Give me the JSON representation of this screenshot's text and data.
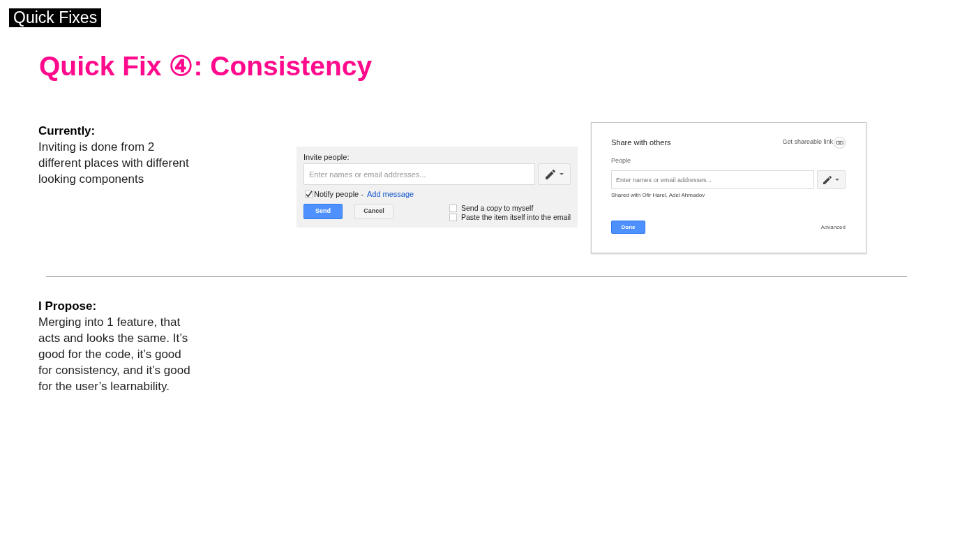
{
  "section_label": "Quick Fixes",
  "title": "Quick Fix ④: Consistency",
  "current": {
    "heading": "Currently:",
    "lines": [
      "Inviting is done from 2",
      "different places with different",
      "looking components"
    ]
  },
  "screenshots": [
    {
      "kind": "invite_panel",
      "label": "Invite people:",
      "input": {
        "placeholder": "Enter names or email addresses..."
      },
      "notify": {
        "label": "Notify people -",
        "checked": true,
        "link": "Add message"
      },
      "buttons": [
        {
          "label": "Send",
          "primary": true
        },
        {
          "label": "Cancel",
          "primary": false
        }
      ],
      "options": [
        {
          "label": "Send a copy to myself",
          "checked": false
        },
        {
          "label": "Paste the item itself into the email",
          "checked": false
        }
      ]
    },
    {
      "kind": "share_dialog",
      "title": "Share with others",
      "link_label": "Get shareable link",
      "field_label": "People",
      "input": {
        "placeholder": "Enter names or email addresses..."
      },
      "shared_with": "Shared with Ofir Harel, Adel Ahmadov",
      "buttons": [
        {
          "label": "Done",
          "primary": true
        }
      ],
      "advanced": "Advanced"
    }
  ],
  "proposal": {
    "heading": "I Propose:",
    "lines": [
      "Merging into 1 feature, that",
      "acts and looks the same. It’s",
      "good for the code, it’s good",
      "for consistency, and it’s good",
      "for the user’s learnability."
    ]
  }
}
